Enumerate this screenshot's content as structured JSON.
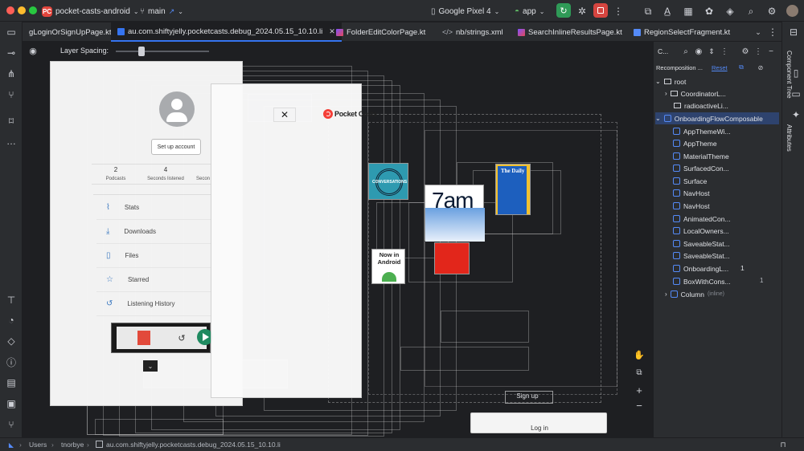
{
  "titlebar": {
    "project_badge": "PC",
    "project_name": "pocket-casts-android",
    "branch": "main",
    "device": "Google Pixel 4",
    "run_config": "app"
  },
  "tabs": [
    {
      "label": "gLoginOrSignUpPage.kt"
    },
    {
      "label": "au.com.shiftyjelly.pocketcasts.debug_2024.05.15_10.10.li"
    },
    {
      "label": "FolderEditColorPage.kt"
    },
    {
      "label": "nb/strings.xml"
    },
    {
      "label": "SearchInlineResultsPage.kt"
    },
    {
      "label": "RegionSelectFragment.kt"
    }
  ],
  "canvas": {
    "layer_spacing_label": "Layer Spacing:",
    "layer_spacing": 0.28
  },
  "preview": {
    "setup_account": "Set up account",
    "stats": [
      {
        "value": "2",
        "label": "Podcasts"
      },
      {
        "value": "4",
        "label": "Seconds listened"
      },
      {
        "value": "",
        "label": "Secon"
      }
    ],
    "menu": [
      "Stats",
      "Downloads",
      "Files",
      "Starred",
      "Listening History"
    ],
    "pocket_casts_brand": "Pocket Casts",
    "covers": {
      "the_daily": "The Daily",
      "seven_am": "7am",
      "now_in_android": "Now in Android",
      "conversations": "CONVERSATIONS"
    },
    "sign_up": "Sign up",
    "log_in": "Log in"
  },
  "component_tree": {
    "header": "C...",
    "recomposition": "Recomposition ...",
    "reset": "Reset",
    "nodes": [
      {
        "label": "root",
        "count": ""
      },
      {
        "label": "CoordinatorL...",
        "count": ""
      },
      {
        "label": "radioactiveLi...",
        "count": ""
      },
      {
        "label": "OnboardingFlowComposable",
        "count": ""
      },
      {
        "label": "AppThemeWi...",
        "count": ""
      },
      {
        "label": "AppTheme",
        "count": ""
      },
      {
        "label": "MaterialTheme",
        "count": ""
      },
      {
        "label": "SurfacedCon...",
        "count": ""
      },
      {
        "label": "Surface",
        "count": ""
      },
      {
        "label": "NavHost",
        "count": ""
      },
      {
        "label": "NavHost",
        "count": ""
      },
      {
        "label": "AnimatedCon...",
        "count": ""
      },
      {
        "label": "LocalOwners...",
        "count": ""
      },
      {
        "label": "SaveableStat...",
        "count": ""
      },
      {
        "label": "SaveableStat...",
        "count": ""
      },
      {
        "label": "OnboardingL...",
        "count": "1"
      },
      {
        "label": "BoxWithCons...",
        "count": "1"
      },
      {
        "label": "Column",
        "count": "(inline)"
      }
    ]
  },
  "side_tabs": {
    "component_tree": "Component Tree",
    "attributes": "Attributes"
  },
  "statusbar": {
    "crumbs": [
      "Users",
      "tnorbye",
      "au.com.shiftyjelly.pocketcasts.debug_2024.05.15_10.10.li"
    ]
  },
  "colors": {
    "accent": "#3574f0",
    "run_green": "#2f9a57",
    "stop_red": "#d64540",
    "pocket_casts_red": "#f43e37"
  }
}
